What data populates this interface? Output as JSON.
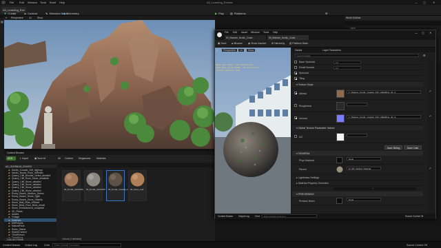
{
  "app": {
    "title": "A3_Learning_Environ",
    "menu": [
      "File",
      "Edit",
      "Window",
      "Tools",
      "Build",
      "Help"
    ],
    "project_tab": "A3_Learning_Env"
  },
  "toolbar": {
    "create_label": "Create",
    "content_label": "Content",
    "selection_label": "Selection Mode",
    "play_label": "Play",
    "platforms_label": "Platforms",
    "geometry_label": "Geometry"
  },
  "viewport": {
    "perspective_label": "Perspective",
    "lit_label": "Lit",
    "show_label": "Show"
  },
  "outliner": {
    "title": "World Outliner",
    "label_col": "Label"
  },
  "content_browser": {
    "tab_label": "Content Browser",
    "add_label": "ADD",
    "import_label": "Import",
    "save_all_label": "Save All",
    "breadcrumb": [
      "All",
      "Content",
      "Megascans",
      "Materials"
    ],
    "tree_root": "A3_LEARNING_ENVIRO",
    "tree_items": [
      "Nordic_Coastal_Cliff_nkjjhnyo",
      "Nordic_Brown_Rock_rf/Weath",
      "Quarry_Cliff_Boulder_Defed_detailed",
      "Quarry_Cliff_Rock_Stone_detailedb",
      "Quarry_Cliff_Stone_detailed",
      "Quarry_Cliff_Stone_detailed",
      "Quarry_Cliff_Stone_detailed",
      "Quarry_Cliff_Stone_detailed",
      "Rocky_Beach_Medium_Debris",
      "Rocky_Beach_Stone_Sjjdb",
      "Rocky_Beach_Stone_Siberify",
      "Stone_Wall_Pillar_rf/Weatl",
      "Stone_Brick_Floor_Brick_rfmatt",
      "Stone_Embankment_vcaqdcde",
      "3D_Plants",
      "Assets",
      "Foliage",
      "Materials",
      "MSPresets",
      "NaturalPack",
      "Ruins_Statue",
      "StarterContent",
      "ThirdPerson",
      "Transitions",
      "Engine Content",
      "Engine Content Plugins"
    ],
    "collections_label": "COLLECTIONS",
    "status_text": "4 items (1 selected)",
    "assets": [
      {
        "name": "MI_Nordic_MASTER_FT",
        "color": "#8a6a4a"
      },
      {
        "name": "MI_Nordic_MASTER",
        "color": "#7e7a72"
      },
      {
        "name": "MI_Nordic_Coastal_Cliff",
        "color": "#5e5248"
      },
      {
        "name": "MI_Stone_Fall",
        "color": "#a07858"
      }
    ]
  },
  "status_bar": {
    "content_drawer": "Content Drawer",
    "output_log": "Output Log",
    "cmd_label": "Cmd",
    "cmd_placeholder": "Enter Console Command",
    "source_control": "Source Control Off"
  },
  "mi_window": {
    "title": "MI_Nordic_Coastal_Cliff",
    "tab": "MI_Massive_Nordic_Coast...",
    "tab2": "MI_Massive_Nordic_Coast...",
    "menu": [
      "File",
      "Edit",
      "Asset",
      "Window",
      "Tools",
      "Help"
    ],
    "toolbar": {
      "save_label": "Save",
      "browse_label": "Browse",
      "show_inactive_label": "Show Inactive",
      "hierarchy_label": "Hierarchy",
      "platform_stats_label": "Platform Stats"
    },
    "viewport": {
      "perspective_label": "Perspective",
      "lit_label": "Lit",
      "show_label": "Show"
    },
    "details_tab": "Details",
    "layer_tab": "Layer Parameters",
    "search_placeholder": "Search Details",
    "rows_top": [
      {
        "label": "Base Specular",
        "value": "0.5"
      },
      {
        "label": "Detail Normal",
        "value": "0.0"
      },
      {
        "label": "Specular",
        "value": "0.0"
      },
      {
        "label": "Tiling",
        "value": "0.0"
      }
    ],
    "texture_group": "Texture Slope",
    "albedo_label": "Albedo",
    "albedo_value": "T_Massive_Nordic_Coastal_Cliff_rnBedRGa_4K_A",
    "roughness_label": "Roughness",
    "normal_label": "Normal",
    "normal_value": "T_Massive_Nordic_Coastal_Cliff_rnBedRGa_4K_N",
    "global_group": "Global Texture Parameter Values",
    "ao_label": "AO",
    "save_sibling_label": "Save Sibling",
    "save_child_label": "Save Child",
    "general_header": "GENERAL",
    "phys_material_label": "Phys Material",
    "phys_material_value": "None",
    "parent_label": "Parent",
    "parent_value": "M_MS_Default_Material",
    "lightmass_label": "Lightmass Settings",
    "material_overrides_label": "Material Property Overrides",
    "previewing_header": "PREVIEWING",
    "preview_mesh_label": "Preview Mesh",
    "preview_mesh_value": "None"
  }
}
